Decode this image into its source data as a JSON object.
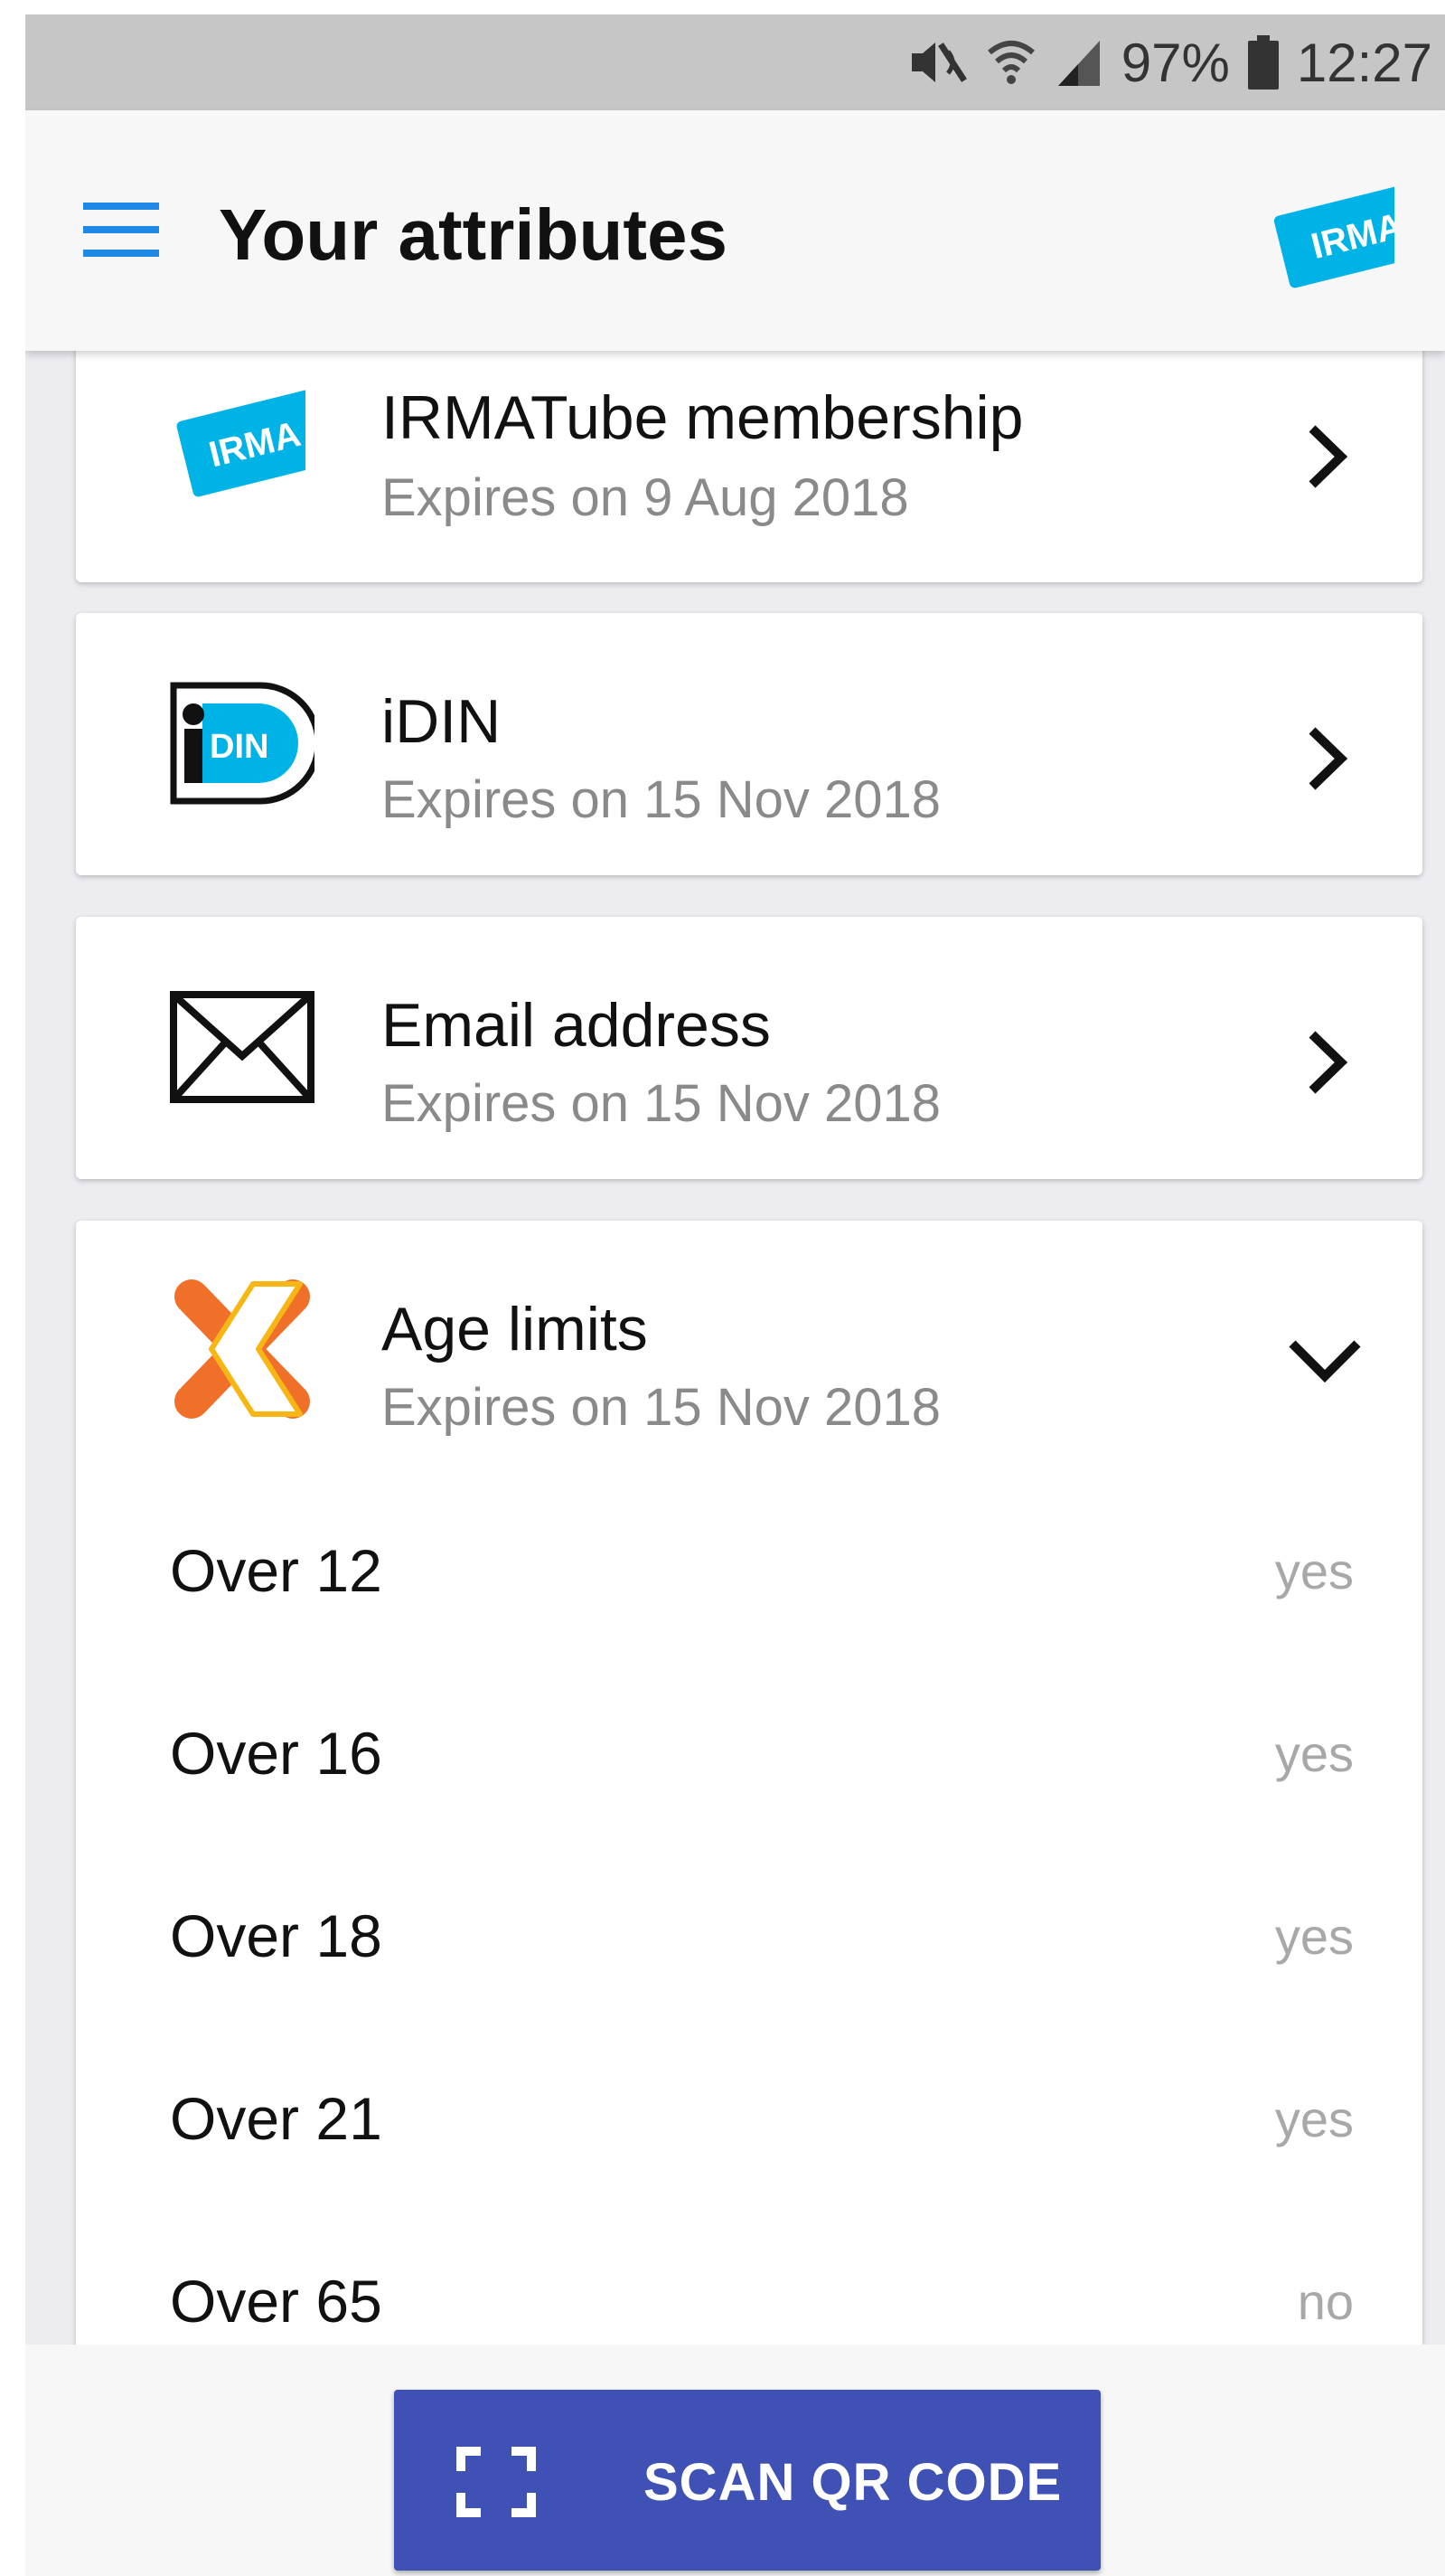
{
  "status_bar": {
    "battery_percent": "97%",
    "time": "12:27",
    "icons": [
      "mute-icon",
      "wifi-icon",
      "signal-icon",
      "battery-icon"
    ]
  },
  "app_bar": {
    "title": "Your attributes",
    "logo_text": "IRMA",
    "icons": [
      "menu-icon",
      "irma-logo"
    ]
  },
  "cards": [
    {
      "title": "IRMATube membership",
      "subtitle": "Expires on 9 Aug 2018",
      "icon": "irma-logo",
      "logo_text": "IRMA",
      "state": "collapsed"
    },
    {
      "title": "iDIN",
      "subtitle": "Expires on 15 Nov 2018",
      "icon": "idin-logo",
      "logo_text": "DIN",
      "state": "collapsed"
    },
    {
      "title": "Email address",
      "subtitle": "Expires on 15 Nov 2018",
      "icon": "envelope-icon",
      "state": "collapsed"
    },
    {
      "title": "Age limits",
      "subtitle": "Expires on 15 Nov 2018",
      "icon": "age-limits-logo",
      "state": "expanded",
      "attributes": [
        {
          "name": "Over 12",
          "value": "yes"
        },
        {
          "name": "Over 16",
          "value": "yes"
        },
        {
          "name": "Over 18",
          "value": "yes"
        },
        {
          "name": "Over 21",
          "value": "yes"
        },
        {
          "name": "Over 65",
          "value": "no"
        }
      ]
    }
  ],
  "scan_button": {
    "label": "SCAN QR CODE",
    "icon": "scan-frame-icon"
  },
  "colors": {
    "accent": "#3f51b5",
    "menu_icon": "#1e88e5",
    "irma_blue": "#00b3e6",
    "age_orange": "#f0702a",
    "age_yellow": "#f7b614"
  }
}
